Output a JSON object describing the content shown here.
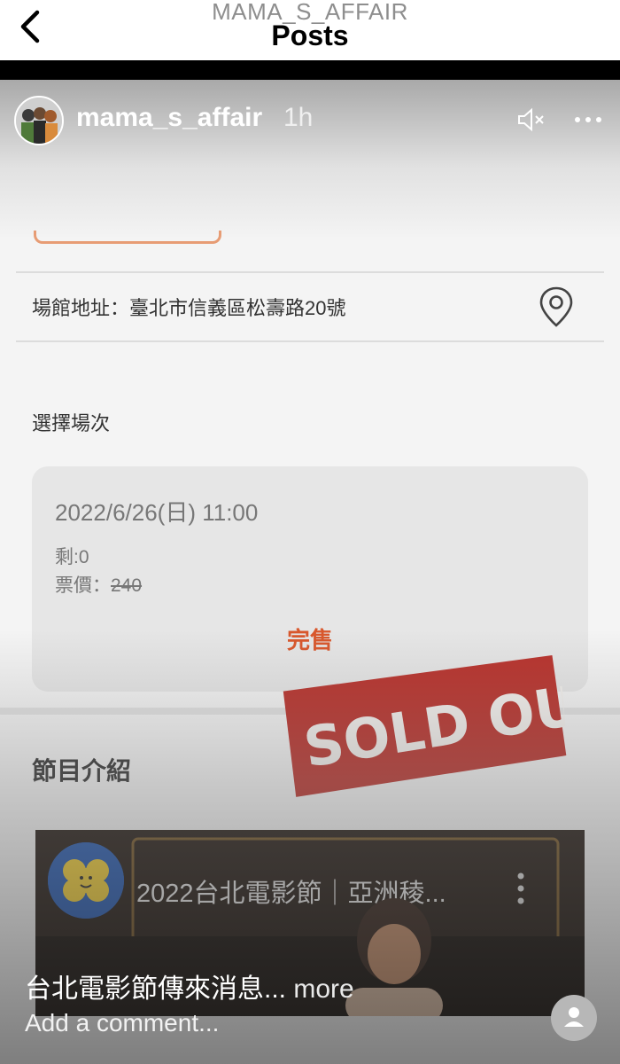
{
  "header": {
    "account": "MAMA_S_AFFAIR",
    "title": "Posts"
  },
  "post": {
    "username": "mama_s_affair",
    "time_ago": "1h",
    "venue_address": "場館地址：臺北市信義區松壽路20號",
    "session_label": "選擇場次",
    "session": {
      "datetime": "2022/6/26(日) 11:00",
      "remaining": "剩:0",
      "price_label": "票價：",
      "price_value": "240",
      "status": "完售"
    },
    "intro_label": "節目介紹",
    "video_title": "2022台北電影節｜亞洲稜...",
    "caption": "台北電影節傳來消息...",
    "caption_more": " more",
    "comment_placeholder": "Add a comment..."
  },
  "colors": {
    "sold_orange": "#d9572c",
    "stamp_red": "#b9322c"
  },
  "icons": [
    "back-chevron-icon",
    "mute-icon",
    "more-options-icon",
    "location-pin-icon",
    "kebab-icon",
    "person-icon"
  ]
}
